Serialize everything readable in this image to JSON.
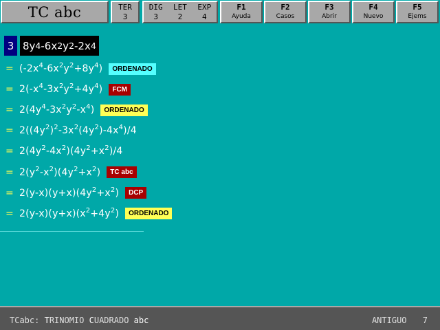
{
  "app": {
    "title": "TC abc"
  },
  "stats": {
    "ter_label": "TER",
    "ter_value": "3",
    "dig_label": "DIG",
    "dig_value": "3",
    "let_label": "LET",
    "let_value": "2",
    "exp_label": "EXP",
    "exp_value": "4"
  },
  "function_keys": [
    {
      "key": "F1",
      "label": "Ayuda"
    },
    {
      "key": "F2",
      "label": "Casos"
    },
    {
      "key": "F3",
      "label": "Abrir"
    },
    {
      "key": "F4",
      "label": "Nuevo"
    },
    {
      "key": "F5",
      "label": "Ejems"
    }
  ],
  "input": {
    "step": "3",
    "expression": "8y⁴-6x²y²-2x⁴"
  },
  "steps": [
    {
      "eq": "=",
      "expr": "(-2x⁴-6x²y²+8y⁴)",
      "tag": "ORDENADO",
      "tag_color": "cyan"
    },
    {
      "eq": "=",
      "expr": "2(-x⁴-3x²y²+4y⁴)",
      "tag": "FCM",
      "tag_color": "red"
    },
    {
      "eq": "=",
      "expr": "2(4y⁴-3x²y²-x⁴)",
      "tag": "ORDENADO",
      "tag_color": "yellow"
    },
    {
      "eq": "=",
      "expr": "2((4y²)²-3x²(4y²)-4x⁴)/4",
      "tag": "",
      "tag_color": ""
    },
    {
      "eq": "=",
      "expr": "2(4y²-4x²)(4y²+x²)/4",
      "tag": "",
      "tag_color": ""
    },
    {
      "eq": "=",
      "expr": "2(y²-x²)(4y²+x²)",
      "tag": "TC abc",
      "tag_color": "red"
    },
    {
      "eq": "=",
      "expr": "2(y-x)(y+x)(4y²+x²)",
      "tag": "DCP",
      "tag_color": "red"
    },
    {
      "eq": "=",
      "expr": "2(y-x)(y+x)(x²+4y²)",
      "tag": "ORDENADO",
      "tag_color": "yellow"
    }
  ],
  "tag_colors": {
    "cyan": {
      "bg": "#55ffff",
      "fg": "#000000"
    },
    "red": {
      "bg": "#a80000",
      "fg": "#ffffff"
    },
    "yellow": {
      "bg": "#ffff55",
      "fg": "#000000"
    }
  },
  "status": {
    "legend_parts": [
      {
        "text": "TCabc: ",
        "hl": false
      },
      {
        "text": "T",
        "hl": true
      },
      {
        "text": "RINOMIO ",
        "hl": false
      },
      {
        "text": "C",
        "hl": true
      },
      {
        "text": "UADRADO ",
        "hl": false
      },
      {
        "text": "abc",
        "hl": true
      }
    ],
    "mode": "ANTIGUO",
    "count": "7"
  }
}
